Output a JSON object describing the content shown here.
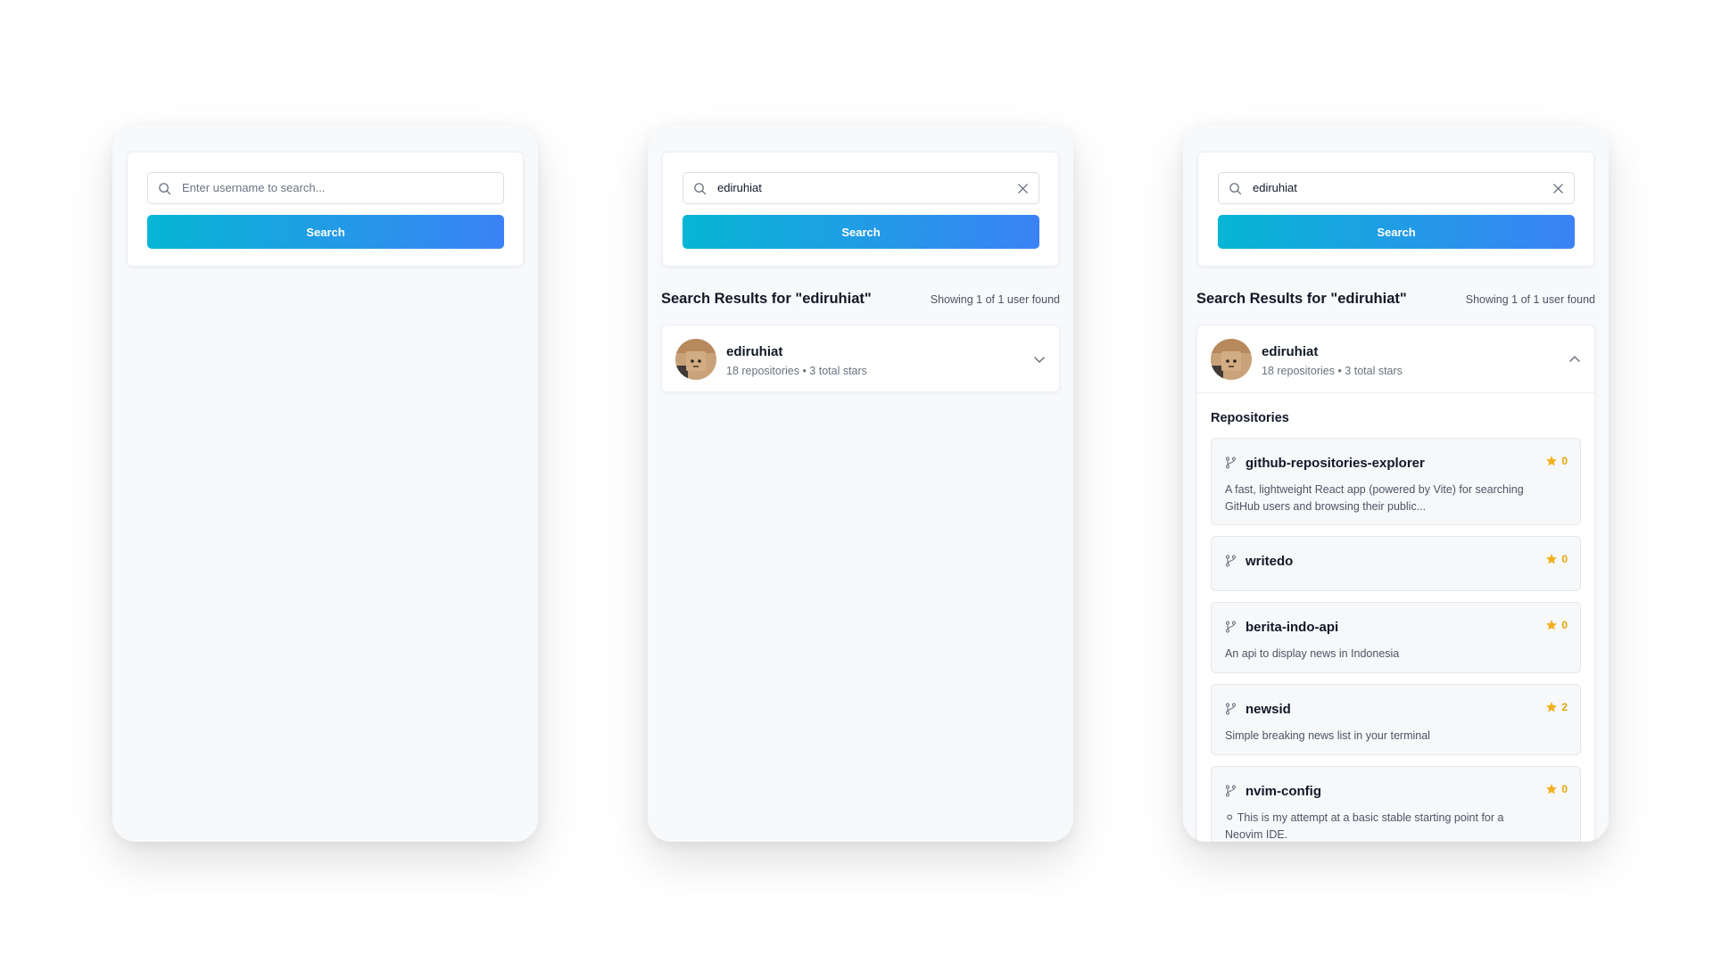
{
  "screens": {
    "empty": {
      "search_placeholder": "Enter username to search...",
      "search_button": "Search"
    },
    "collapsed": {
      "search_value": "ediruhiat",
      "search_button": "Search",
      "results_title": "Search Results for \"ediruhiat\"",
      "results_count": "Showing 1 of 1 user found",
      "user": {
        "username": "ediruhiat",
        "meta": "18  repositories • 3 total stars"
      }
    },
    "expanded": {
      "search_value": "ediruhiat",
      "search_button": "Search",
      "results_title": "Search Results for \"ediruhiat\"",
      "results_count": "Showing 1 of 1 user found",
      "user": {
        "username": "ediruhiat",
        "meta": "18  repositories • 3 total stars"
      },
      "repositories_title": "Repositories",
      "repos": [
        {
          "name": "github-repositories-explorer",
          "stars": "0",
          "description": "A fast, lightweight React app (powered by Vite) for searching GitHub users and browsing their public..."
        },
        {
          "name": "writedo",
          "stars": "0",
          "description": ""
        },
        {
          "name": "berita-indo-api",
          "stars": "0",
          "description": "An api to display news in Indonesia"
        },
        {
          "name": "newsid",
          "stars": "2",
          "description": "Simple breaking news list in your terminal"
        },
        {
          "name": "nvim-config",
          "stars": "0",
          "description": "⚪ This is my attempt at a basic stable starting point for a Neovim IDE."
        }
      ]
    }
  },
  "colors": {
    "button_gradient_start": "#06b6d4",
    "button_gradient_end": "#3b82f6",
    "star": "#f2b01e",
    "star_count": "#e5a50a"
  },
  "icons": {
    "search": "search-icon",
    "clear": "close-icon",
    "collapse": "chevron-down-icon",
    "expand": "chevron-up-icon",
    "repo": "fork-icon",
    "star": "star-icon"
  }
}
